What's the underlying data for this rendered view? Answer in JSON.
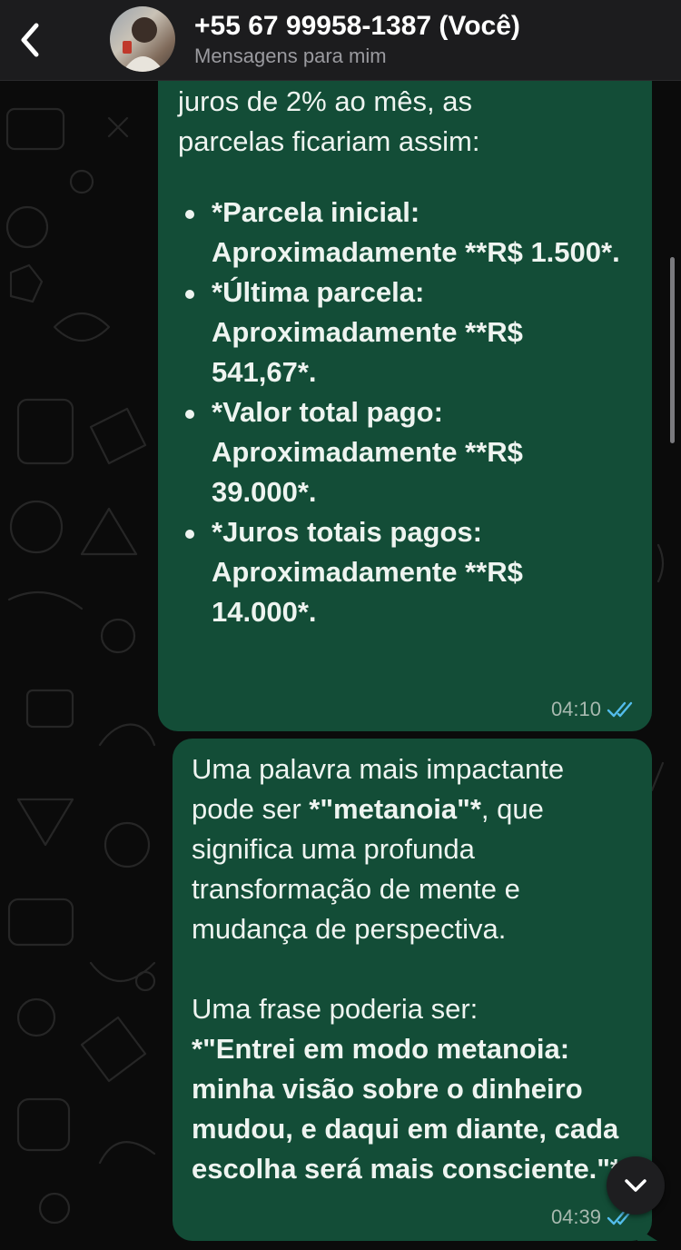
{
  "header": {
    "contact_name": "+55 67 99958-1387 (Você)",
    "contact_subtitle": "Mensagens para mim",
    "back_icon": "chevron-left-icon"
  },
  "colors": {
    "bubble": "#134d37",
    "background": "#0b0b0b",
    "header": "#1c1c1e",
    "read_ticks": "#53bdeb"
  },
  "messages": [
    {
      "intro_line_1": "juros de 2% ao mês, as",
      "intro_line_2": "parcelas ficariam assim:",
      "items": [
        "*Parcela inicial: Aproximadamente **R$ 1.500*.",
        "*Última parcela: Aproximadamente **R$ 541,67*.",
        "*Valor total pago: Aproximadamente **R$ 39.000*.",
        "*Juros totais pagos: Aproximadamente **R$ 14.000*."
      ],
      "time": "04:10",
      "status_icon": "double-check-read-icon"
    },
    {
      "p1_before": "Uma palavra mais impactante pode ser ",
      "p1_bold": "*\"metanoia\"*",
      "p1_after": ", que significa uma profunda transformação de mente e mudança de perspectiva.",
      "p2": "Uma frase poderia ser:",
      "p3_bold": "*\"Entrei em modo metanoia: minha visão sobre o dinheiro mudou, e daqui em diante, cada escolha será mais consciente.\"*",
      "time": "04:39",
      "status_icon": "double-check-read-icon"
    }
  ],
  "scroll_down_icon": "chevron-down-icon"
}
